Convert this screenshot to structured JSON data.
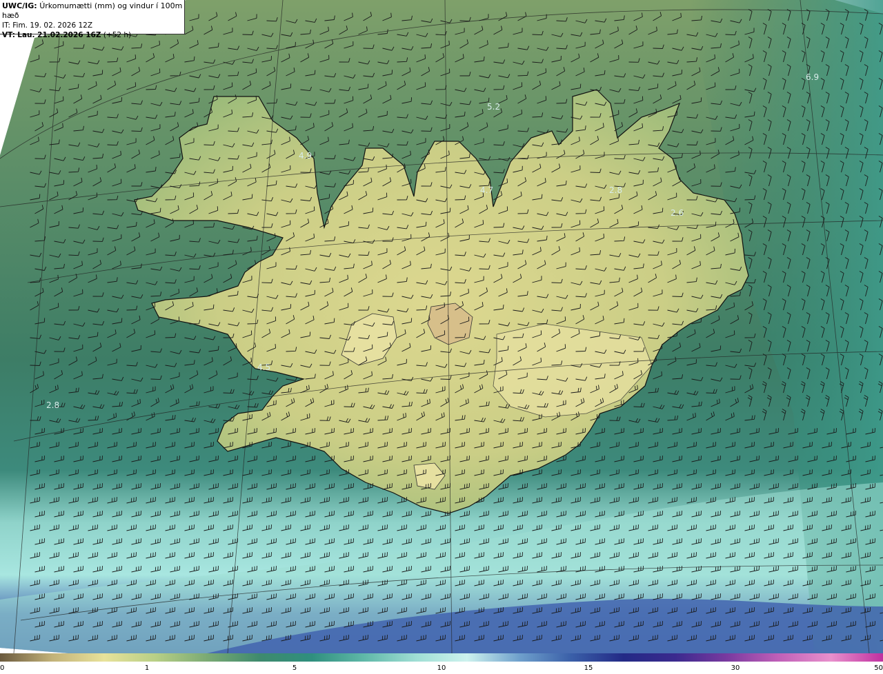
{
  "header": {
    "model": "UWC/IG:",
    "title": "Úrkomumætti (mm) og vindur í 100m hæð",
    "it_prefix": "IT:",
    "it_value": "Fim. 19. 02. 2026 12Z",
    "vt_prefix": "VT:",
    "vt_value": "Lau. 21.02.2026 16Z",
    "vt_lead": "(+52 h)"
  },
  "value_labels": [
    "6.9",
    "5.2",
    "4.9",
    "4.7",
    "2.8",
    "2.6",
    "4.5",
    "2.8"
  ],
  "colorbar": {
    "ticks": [
      "0",
      "1",
      "5",
      "10",
      "15",
      "30",
      "50"
    ],
    "colors": [
      "#6b5a3e",
      "#c2b279",
      "#e8e29a",
      "#b8cf86",
      "#7aaa74",
      "#3e8a6e",
      "#2f8f7e",
      "#5fb8a8",
      "#9fded4",
      "#cdf2ee",
      "#6fa0cc",
      "#3a5fa8",
      "#232a86",
      "#3b2a8e",
      "#7a3aa0",
      "#c060b8",
      "#e890cc",
      "#c030a0"
    ]
  },
  "colors": {
    "field_north": "#5e8f68",
    "field_south": "#3f6fae",
    "land": "#d9d68e",
    "coast": "#111111"
  }
}
